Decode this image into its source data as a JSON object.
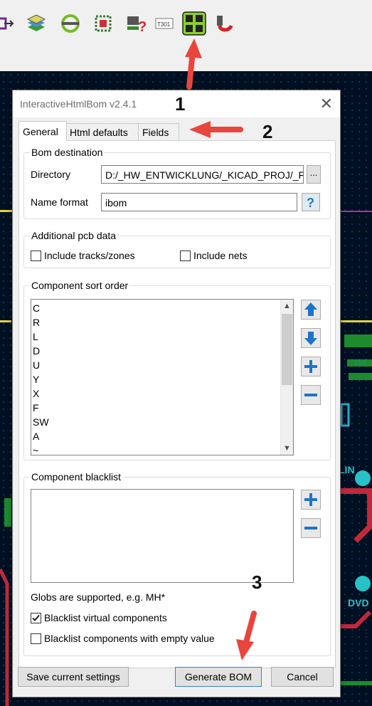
{
  "dialog": {
    "title": "InteractiveHtmlBom v2.4.1",
    "tabs": [
      "General",
      "Html defaults",
      "Fields"
    ]
  },
  "bom_destination": {
    "heading": "Bom destination",
    "directory_label": "Directory",
    "directory_value": "D:/_HW_ENTWICKLUNG/_KICAD_PROJ/_FL",
    "browse_label": "...",
    "name_format_label": "Name format",
    "name_format_value": "ibom"
  },
  "additional_pcb_data": {
    "heading": "Additional pcb data",
    "include_tracks_label": "Include tracks/zones",
    "include_tracks_checked": false,
    "include_nets_label": "Include nets",
    "include_nets_checked": false
  },
  "sort_order": {
    "heading": "Component sort order",
    "items": [
      "C",
      "R",
      "L",
      "D",
      "U",
      "Y",
      "X",
      "F",
      "SW",
      "A",
      "~"
    ]
  },
  "blacklist": {
    "heading": "Component blacklist",
    "items": [],
    "globs_note": "Globs are supported, e.g. MH*",
    "virtual_label": "Blacklist virtual components",
    "virtual_checked": true,
    "empty_value_label": "Blacklist components with empty value",
    "empty_value_checked": false
  },
  "buttons": {
    "save": "Save current settings",
    "generate": "Generate BOM",
    "cancel": "Cancel"
  },
  "annotations": [
    "1",
    "2",
    "3"
  ],
  "colors": {
    "pcb_background": "#001023",
    "annotation_arrow": "#e8453c",
    "toolbar_icon_highlight": "#8bd12a",
    "arrow_button_blue": "#1e74c8"
  }
}
